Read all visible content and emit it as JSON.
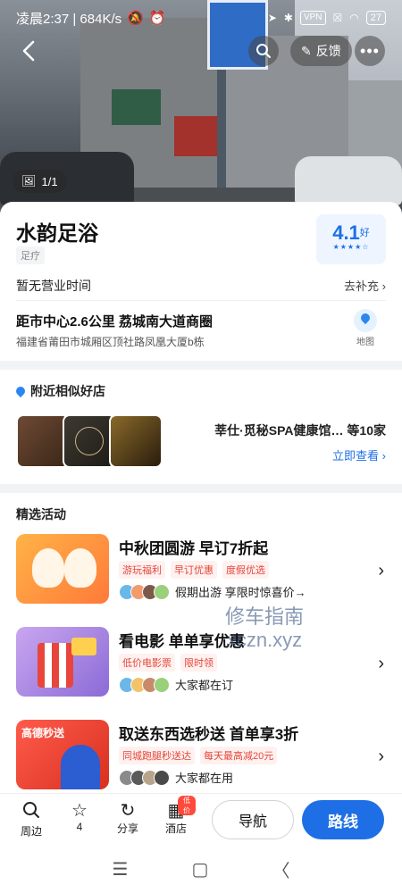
{
  "status_bar": {
    "time_speed": "凌晨2:37 | 684K/s",
    "vpn": "VPN",
    "battery": "27"
  },
  "header": {
    "feedback_label": "反馈",
    "photo_count": "1/1"
  },
  "shop": {
    "name": "水韵足浴",
    "category": "足疗",
    "rating": "4.1",
    "rating_word": "好",
    "stars": "★★★★☆",
    "hours": "暂无营业时间",
    "supplement": "去补充",
    "distance": "距市中心2.6公里  荔城南大道商圈",
    "address": "福建省莆田市城厢区顶社路凤凰大厦b栋",
    "map_label": "地图"
  },
  "nearby": {
    "title": "附近相似好店",
    "names": "莘仕·觅秘SPA健康馆…",
    "count": "等10家",
    "view_now": "立即查看"
  },
  "activities": {
    "title": "精选活动",
    "items": [
      {
        "title": "中秋团圆游 早订7折起",
        "tags": [
          "游玩福利",
          "早订优惠",
          "度假优选"
        ],
        "bottom": "假期出游 享限时惊喜价→"
      },
      {
        "title": "看电影 单单享优惠",
        "tags": [
          "低价电影票",
          "限时领"
        ],
        "bottom": "大家都在订"
      },
      {
        "title": "取送东西选秒送 首单享3折",
        "tags": [
          "同城跑腿秒送达",
          "每天最高减20元"
        ],
        "bottom": "大家都在用",
        "image_text": "高德秒送"
      }
    ]
  },
  "watermark": {
    "line1": "修车指南",
    "line2": "xczn.xyz"
  },
  "toolbar": {
    "nearby": "周边",
    "star_count": "4",
    "share": "分享",
    "hotel": "酒店",
    "hotel_badge": "低价",
    "navigate": "导航",
    "route": "路线"
  },
  "colors": {
    "accent": "#1e6fe6",
    "tag_red": "#e4473b"
  }
}
